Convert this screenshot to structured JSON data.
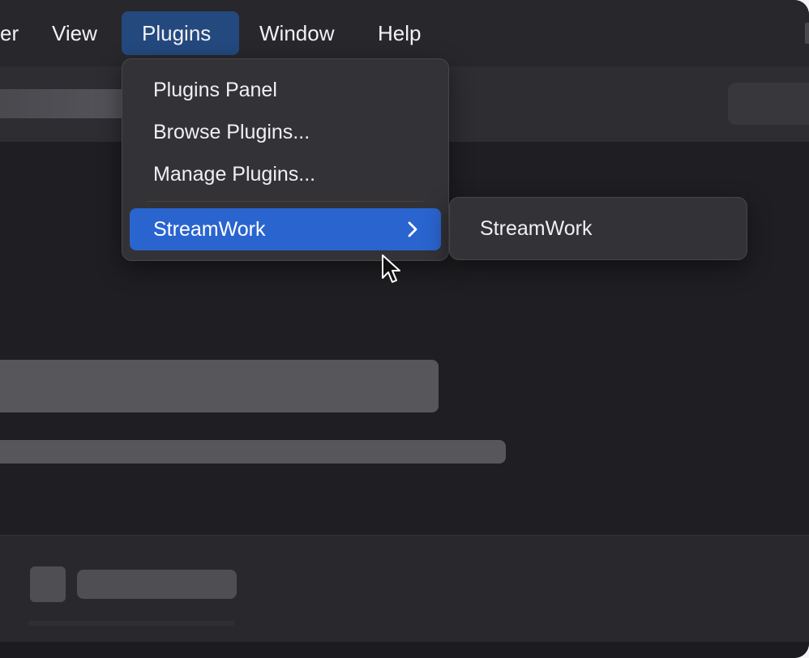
{
  "menubar": {
    "items": [
      {
        "label": "er"
      },
      {
        "label": "View"
      },
      {
        "label": "Plugins",
        "active": true
      },
      {
        "label": "Window"
      },
      {
        "label": "Help"
      }
    ]
  },
  "dropdown": {
    "items": [
      {
        "label": "Plugins Panel"
      },
      {
        "label": "Browse Plugins..."
      },
      {
        "label": "Manage Plugins..."
      },
      {
        "label": "StreamWork",
        "has_submenu": true,
        "highlighted": true
      }
    ],
    "chevron_icon": "chevron-right-icon"
  },
  "submenu": {
    "items": [
      {
        "label": "StreamWork"
      }
    ]
  },
  "colors": {
    "highlight": "#2a64cf",
    "active_menu": "#24497f",
    "window_bg": "#1f1e22",
    "menu_bg": "#333236"
  }
}
